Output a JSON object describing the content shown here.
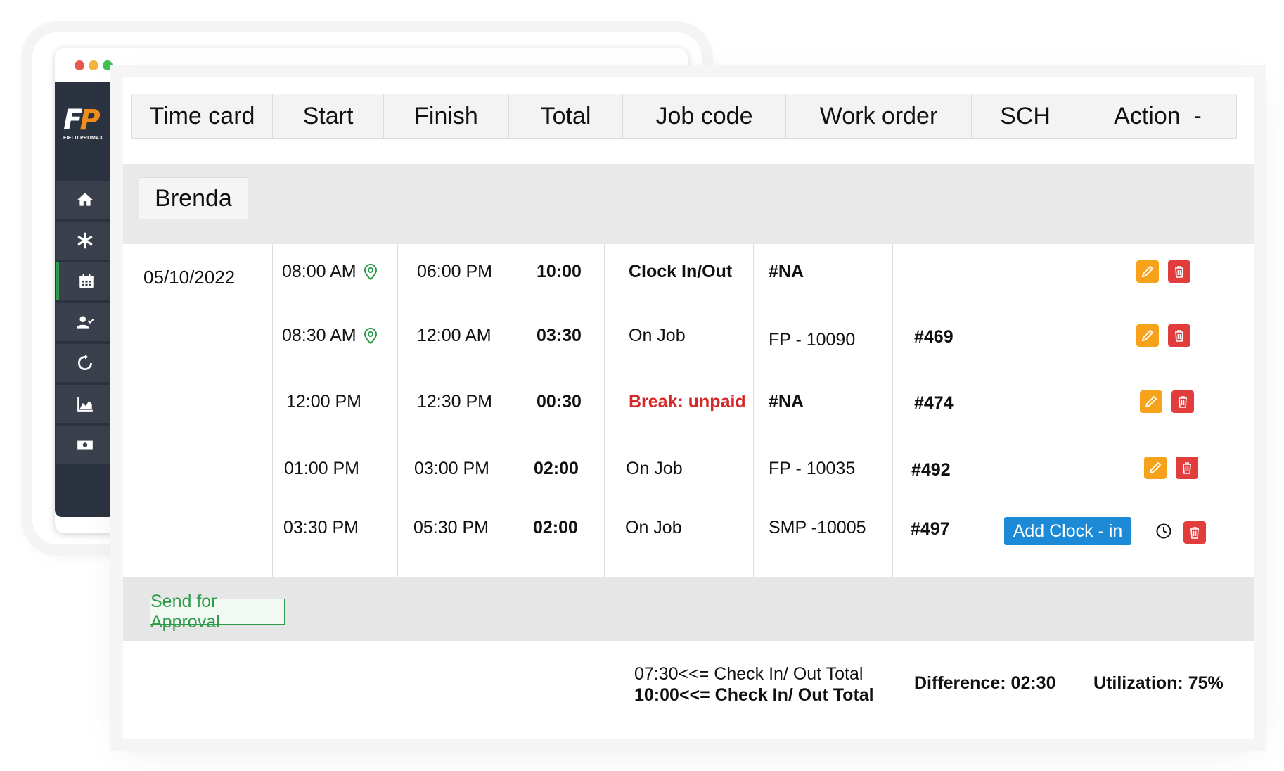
{
  "window": {
    "dot_colors": [
      "#e8584d",
      "#f3b33d",
      "#3fbf4f"
    ]
  },
  "brand": {
    "logo_text_a": "F",
    "logo_text_b": "P",
    "logo_sub": "FIELD PROMAX"
  },
  "sidebar": {
    "items": [
      {
        "icon": "home-icon"
      },
      {
        "icon": "asterisk-icon"
      },
      {
        "icon": "calendar-icon",
        "active": true
      },
      {
        "icon": "user-check-icon"
      },
      {
        "icon": "refresh-icon"
      },
      {
        "icon": "chart-icon"
      },
      {
        "icon": "money-icon"
      }
    ]
  },
  "table": {
    "headers": [
      "Time card",
      "Start",
      "Finish",
      "Total",
      "Job code",
      "Work order",
      "SCH",
      "Action  -"
    ],
    "employee": "Brenda",
    "date": "05/10/2022",
    "rows": [
      {
        "start": "08:00 AM",
        "finish": "06:00 PM",
        "total": "10:00",
        "job_code": "Clock In/Out",
        "work_order": "#NA",
        "sch": ""
      },
      {
        "start": "08:30 AM",
        "finish": "12:00 AM",
        "total": "03:30",
        "job_code": "On Job",
        "work_order": "FP - 10090",
        "sch": "#469"
      },
      {
        "start": "12:00 PM",
        "finish": "12:30 PM",
        "total": "00:30",
        "job_code": "Break: unpaid",
        "work_order": "#NA",
        "sch": "#474"
      },
      {
        "start": "01:00 PM",
        "finish": "03:00 PM",
        "total": "02:00",
        "job_code": "On Job",
        "work_order": "FP - 10035",
        "sch": "#492"
      },
      {
        "start": "03:30 PM",
        "finish": "05:30 PM",
        "total": "02:00",
        "job_code": "On Job",
        "work_order": "SMP -10005",
        "sch": "#497"
      }
    ],
    "add_clock_label": "Add Clock - in"
  },
  "footer": {
    "send_label": "Send for Approval",
    "summary_line1": "07:30<<= Check In/ Out Total",
    "summary_line2": "10:00<<= Check In/ Out Total",
    "difference": "Difference: 02:30",
    "utilization": "Utilization: 75%"
  },
  "colors": {
    "accent_green": "#2e9b4a",
    "edit_orange": "#f7a21b",
    "delete_red": "#e23d3d",
    "add_blue": "#1c8ad6",
    "break_red": "#d62828",
    "sidebar_bg": "#2c3340"
  }
}
